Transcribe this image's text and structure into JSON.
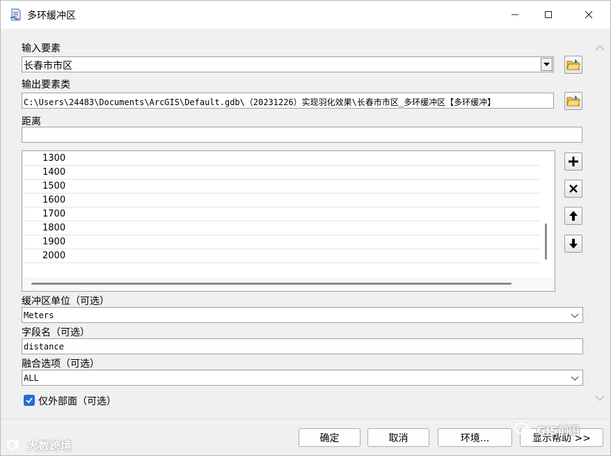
{
  "window": {
    "title": "多环缓冲区",
    "icon": "arctoolbox-script-icon"
  },
  "input_features": {
    "label": "输入要素",
    "value": "长春市市区"
  },
  "output_feature_class": {
    "label": "输出要素类",
    "value": "C:\\Users\\24483\\Documents\\ArcGIS\\Default.gdb\\（20231226）实现羽化效果\\长春市市区_多环缓冲区【多环缓冲】"
  },
  "distances": {
    "label": "距离",
    "input_value": "",
    "items": [
      "1300",
      "1400",
      "1500",
      "1600",
      "1700",
      "1800",
      "1900",
      "2000"
    ]
  },
  "buffer_unit": {
    "label": "缓冲区单位（可选）",
    "value": "Meters"
  },
  "field_name": {
    "label": "字段名（可选）",
    "value": "distance"
  },
  "dissolve_option": {
    "label": "融合选项（可选）",
    "value": "ALL"
  },
  "outside_polygons_only": {
    "label": "仅外部面（可选）",
    "checked": true
  },
  "buttons": {
    "ok": "确定",
    "cancel": "取消",
    "environments": "环境...",
    "show_help": "显示帮助 >>"
  },
  "watermarks": {
    "left": "大数跨境",
    "right": "GIS前沿"
  },
  "colors": {
    "checkbox_accent": "#1e6fd9",
    "titlebar_bg": "#ffffff",
    "dialog_bg": "#f0f0f0"
  }
}
